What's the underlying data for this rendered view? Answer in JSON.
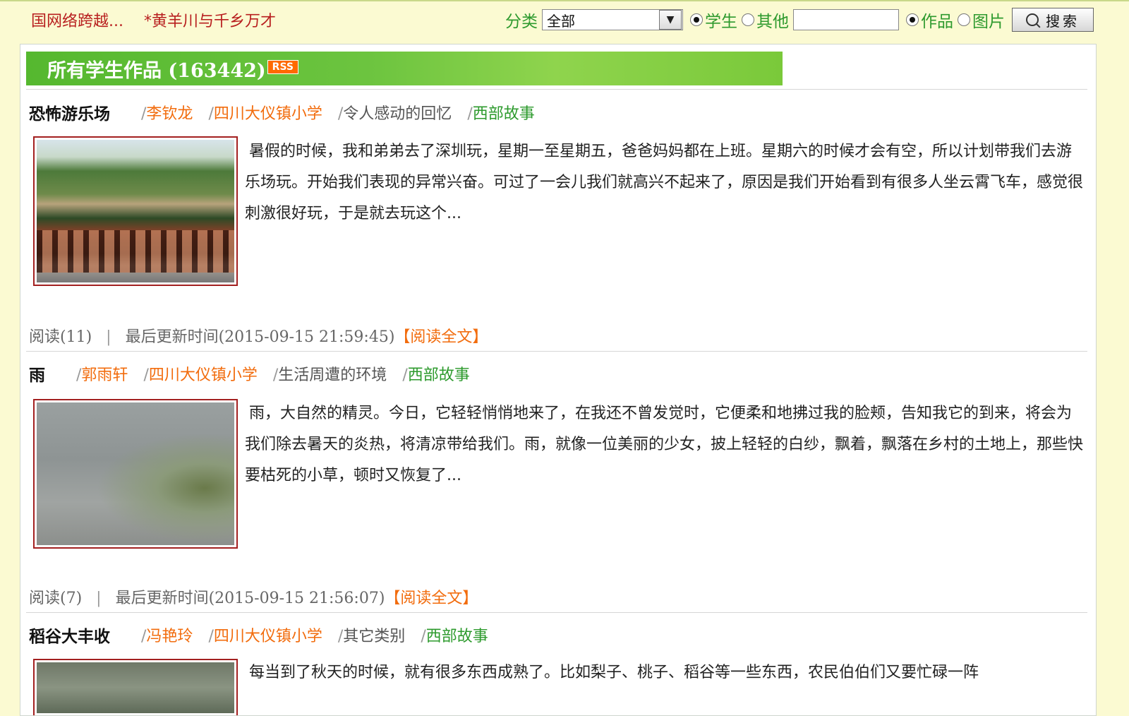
{
  "marquee": [
    "国网络跨越...",
    "*黄羊川与千乡万才"
  ],
  "search": {
    "category_label": "分类",
    "category_value": "全部",
    "radio_student": "学生",
    "radio_other": "其他",
    "keyword_value": "",
    "radio_work": "作品",
    "radio_picture": "图片",
    "button": "搜索"
  },
  "banner": {
    "title": "所有学生作品 (163442)",
    "rss": "RSS"
  },
  "items": [
    {
      "title": "恐怖游乐场",
      "author": "李钦龙",
      "school": "四川大仪镇小学",
      "category": "令人感动的回忆",
      "column": "西部故事",
      "excerpt": "暑假的时候，我和弟弟去了深圳玩，星期一至星期五，爸爸妈妈都在上班。星期六的时候才会有空，所以计划带我们去游乐场玩。开始我们表现的异常兴奋。可过了一会儿我们就高兴不起来了，原因是我们开始看到有很多人坐云霄飞车，感觉很刺激很好玩，于是就去玩这个...",
      "reads": "阅读(11)",
      "updated": "最后更新时间(2015-09-15 21:59:45)",
      "read_link": "【阅读全文】"
    },
    {
      "title": "雨",
      "author": "郭雨轩",
      "school": "四川大仪镇小学",
      "category": "生活周遭的环境",
      "column": "西部故事",
      "excerpt": "雨，大自然的精灵。今日，它轻轻悄悄地来了，在我还不曾发觉时，它便柔和地拂过我的脸颊，告知我它的到来，将会为我们除去暑天的炎热，将清凉带给我们。雨，就像一位美丽的少女，披上轻轻的白纱，飘着，飘落在乡村的土地上，那些快要枯死的小草，顿时又恢复了...",
      "reads": "阅读(7)",
      "updated": "最后更新时间(2015-09-15 21:56:07)",
      "read_link": "【阅读全文】"
    },
    {
      "title": "稻谷大丰收",
      "author": "冯艳玲",
      "school": "四川大仪镇小学",
      "category": "其它类别",
      "column": "西部故事",
      "excerpt": "每当到了秋天的时候，就有很多东西成熟了。比如梨子、桃子、稻谷等一些东西，农民伯伯们又要忙碌一阵"
    }
  ],
  "colors": {
    "background": "#fbfad2",
    "banner_green": "#6cc43f",
    "orange": "#f26c0d",
    "green": "#2c9a2c",
    "thumb_border": "#a32020"
  }
}
